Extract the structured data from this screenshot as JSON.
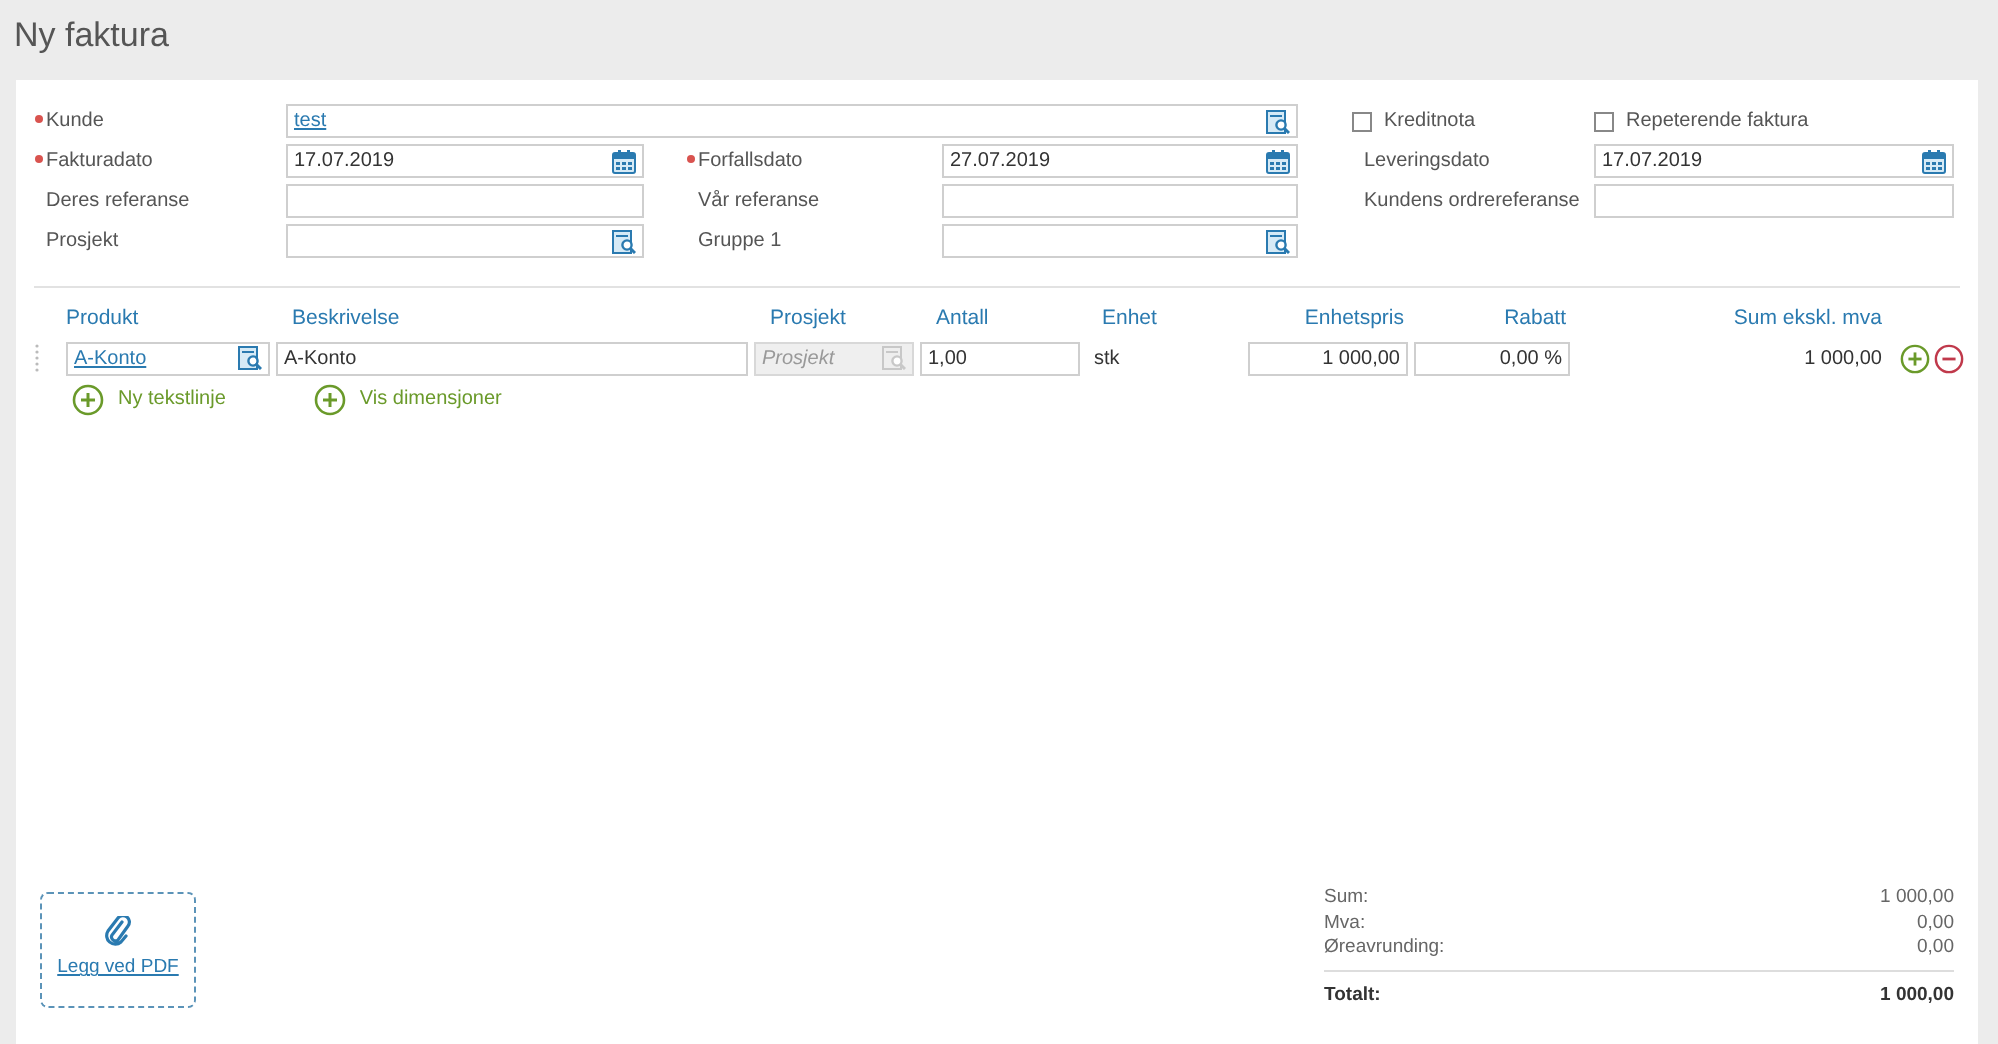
{
  "title": "Ny faktura",
  "customer": {
    "label": "Kunde",
    "required": true,
    "value": "test"
  },
  "checkboxes": [
    {
      "label": "Kreditnota",
      "checked": false
    },
    {
      "label": "Repeterende faktura",
      "checked": false
    }
  ],
  "field_rows": [
    [
      {
        "label": "Fakturadato",
        "required": true,
        "kind": "date",
        "value": "17.07.2019"
      },
      {
        "label": "Forfallsdato",
        "required": true,
        "kind": "date",
        "value": "27.07.2019"
      },
      {
        "label": "Leveringsdato",
        "required": false,
        "kind": "date",
        "value": "17.07.2019"
      }
    ],
    [
      {
        "label": "Deres referanse",
        "required": false,
        "kind": "text"
      },
      {
        "label": "Vår referanse",
        "required": false,
        "kind": "text"
      },
      {
        "label": "Kundens ordrereferanse",
        "required": false,
        "kind": "text"
      }
    ],
    [
      {
        "label": "Prosjekt",
        "required": false,
        "kind": "lookup"
      },
      {
        "label": "Gruppe 1",
        "required": false,
        "kind": "lookup"
      }
    ]
  ],
  "lines": {
    "columns": [
      "Produkt",
      "Beskrivelse",
      "Prosjekt",
      "Antall",
      "Enhet",
      "Enhetspris",
      "Rabatt",
      "Sum ekskl. mva"
    ],
    "rows": [
      {
        "product": "A-Konto",
        "description": "A-Konto",
        "project_placeholder": "Prosjekt",
        "project_disabled": true,
        "quantity": "1,00",
        "unit": "stk",
        "unit_price": "1 000,00",
        "discount": "0,00 %",
        "sum": "1 000,00"
      }
    ],
    "actions": [
      "Ny tekstlinje",
      "Vis dimensjoner"
    ]
  },
  "attachment": {
    "label": "Legg ved PDF"
  },
  "totals": [
    {
      "label": "Sum:",
      "value": "1 000,00"
    },
    {
      "label": "Mva:",
      "value": "0,00"
    },
    {
      "label": "Øreavrunding:",
      "value": "0,00"
    }
  ],
  "total": {
    "label": "Totalt:",
    "value": "1 000,00"
  }
}
